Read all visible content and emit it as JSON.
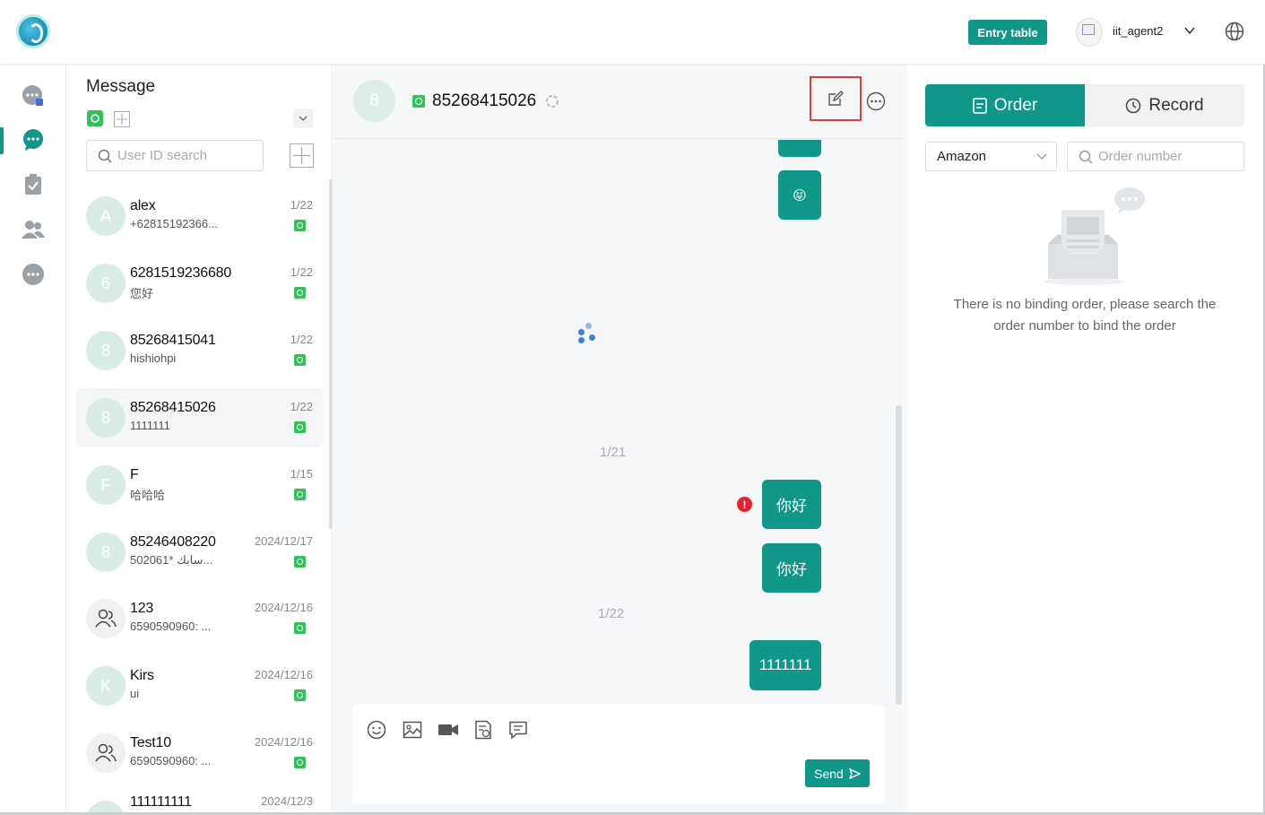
{
  "header": {
    "entry_table_label": "Entry table",
    "username": "iit_agent2"
  },
  "sidebar": {
    "items": [
      {
        "name": "chat-bubble-badge-icon"
      },
      {
        "name": "chat-bubble-icon",
        "active": true
      },
      {
        "name": "clipboard-check-icon"
      },
      {
        "name": "users-icon"
      },
      {
        "name": "more-dots-icon"
      }
    ]
  },
  "message_list": {
    "title": "Message",
    "search_placeholder": "User ID search",
    "conversations": [
      {
        "initial": "A",
        "name": "alex",
        "preview": "+62815192366...",
        "date": "1/22"
      },
      {
        "initial": "6",
        "name": "6281519236680",
        "preview": "您好",
        "date": "1/22"
      },
      {
        "initial": "8",
        "name": "85268415041",
        "preview": "hishiohpi",
        "date": "1/22"
      },
      {
        "initial": "8",
        "name": "85268415026",
        "preview": "1111111",
        "date": "1/22",
        "active": true
      },
      {
        "initial": "F",
        "name": "F",
        "preview": "哈哈哈",
        "date": "1/15"
      },
      {
        "initial": "8",
        "name": "85246408220",
        "preview": "502061* سابك...",
        "date": "2024/12/17"
      },
      {
        "initial": "",
        "group": true,
        "name": "123",
        "preview": "6590590960: ...",
        "date": "2024/12/16"
      },
      {
        "initial": "K",
        "name": "Kirs",
        "preview": "ui",
        "date": "2024/12/16"
      },
      {
        "initial": "",
        "group": true,
        "name": "Test10",
        "preview": "6590590960: ...",
        "date": "2024/12/16"
      },
      {
        "initial": "",
        "name": "111111111",
        "preview": "",
        "date": "2024/12/3"
      }
    ]
  },
  "chat": {
    "avatar_initial": "8",
    "contact_name": "85268415026",
    "date_sep_1": "1/21",
    "date_sep_2": "1/22",
    "messages": [
      {
        "text": "😝"
      },
      {
        "text": "你好",
        "error": true
      },
      {
        "text": "你好"
      },
      {
        "text": "1111111"
      }
    ],
    "error_mark": "!",
    "send_label": "Send"
  },
  "order_panel": {
    "tab_order": "Order",
    "tab_record": "Record",
    "platform": "Amazon",
    "order_placeholder": "Order number",
    "empty_text": "There is no binding order, please search the order number to bind the order"
  },
  "colors": {
    "accent": "#11968a",
    "whatsapp": "#34c05a",
    "error": "#e8202e",
    "highlight_box": "#d9423a"
  }
}
